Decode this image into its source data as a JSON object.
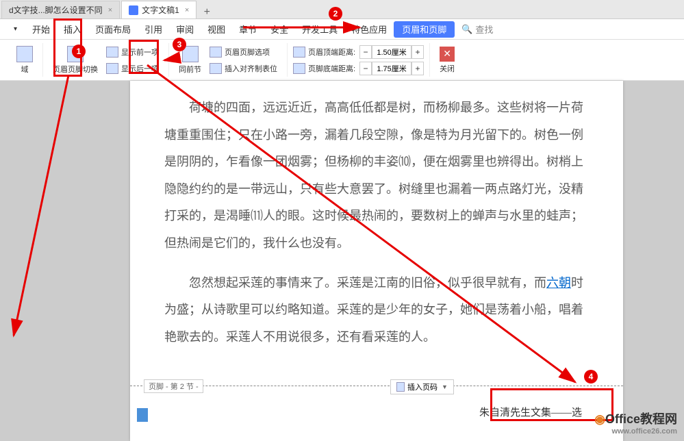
{
  "tabs": [
    {
      "label": "d文字技...脚怎么设置不同"
    },
    {
      "label": "文字文稿1"
    }
  ],
  "menu": {
    "items": [
      "开始",
      "插入",
      "页面布局",
      "引用",
      "审阅",
      "视图",
      "章节",
      "安全",
      "开发工具",
      "特色应用"
    ],
    "activeTab": "页眉和页脚",
    "search": "查找"
  },
  "ribbon": {
    "group1": {
      "label": "域"
    },
    "group2": {
      "main": "页眉页脚切换",
      "row1": "显示前一项",
      "row2": "显示后一项"
    },
    "group3": {
      "main": "同前节",
      "row1": "页眉页脚选项",
      "row2": "插入对齐制表位"
    },
    "group4": {
      "row1Label": "页眉顶端距离:",
      "row1Val": "1.50厘米",
      "row2Label": "页脚底端距离:",
      "row2Val": "1.75厘米"
    },
    "close": "关闭"
  },
  "document": {
    "para1": "荷塘的四面，远远近近，高高低低都是树，而杨柳最多。这些树将一片荷塘重重围住；只在小路一旁，漏着几段空隙，像是特为月光留下的。树色一例是阴阴的，乍看像一团烟雾；但杨柳的丰姿⑽，便在烟雾里也辨得出。树梢上隐隐约约的是一带远山，只有些大意罢了。树缝里也漏着一两点路灯光，没精打采的，是渴睡⑾人的眼。这时候最热闹的，要数树上的蝉声与水里的蛙声；但热闹是它们的，我什么也没有。",
    "para2Start": "忽然想起采莲的事情来了。采莲是江南的旧俗，似乎很早就有，而",
    "para2Link": "六朝",
    "para2End": "时为盛；从诗歌里可以约略知道。采莲的是少年的女子，她们是荡着小船，唱着艳歌去的。采莲人不用说很多，还有看采莲的人。",
    "footerLabel": "页脚 - 第 2 节 -",
    "insertPageNum": "插入页码",
    "footerText": "朱自清先生文集——选"
  },
  "callouts": [
    "1",
    "2",
    "3",
    "4"
  ],
  "watermark": {
    "brand": "Office教程网",
    "url": "www.office26.com"
  }
}
